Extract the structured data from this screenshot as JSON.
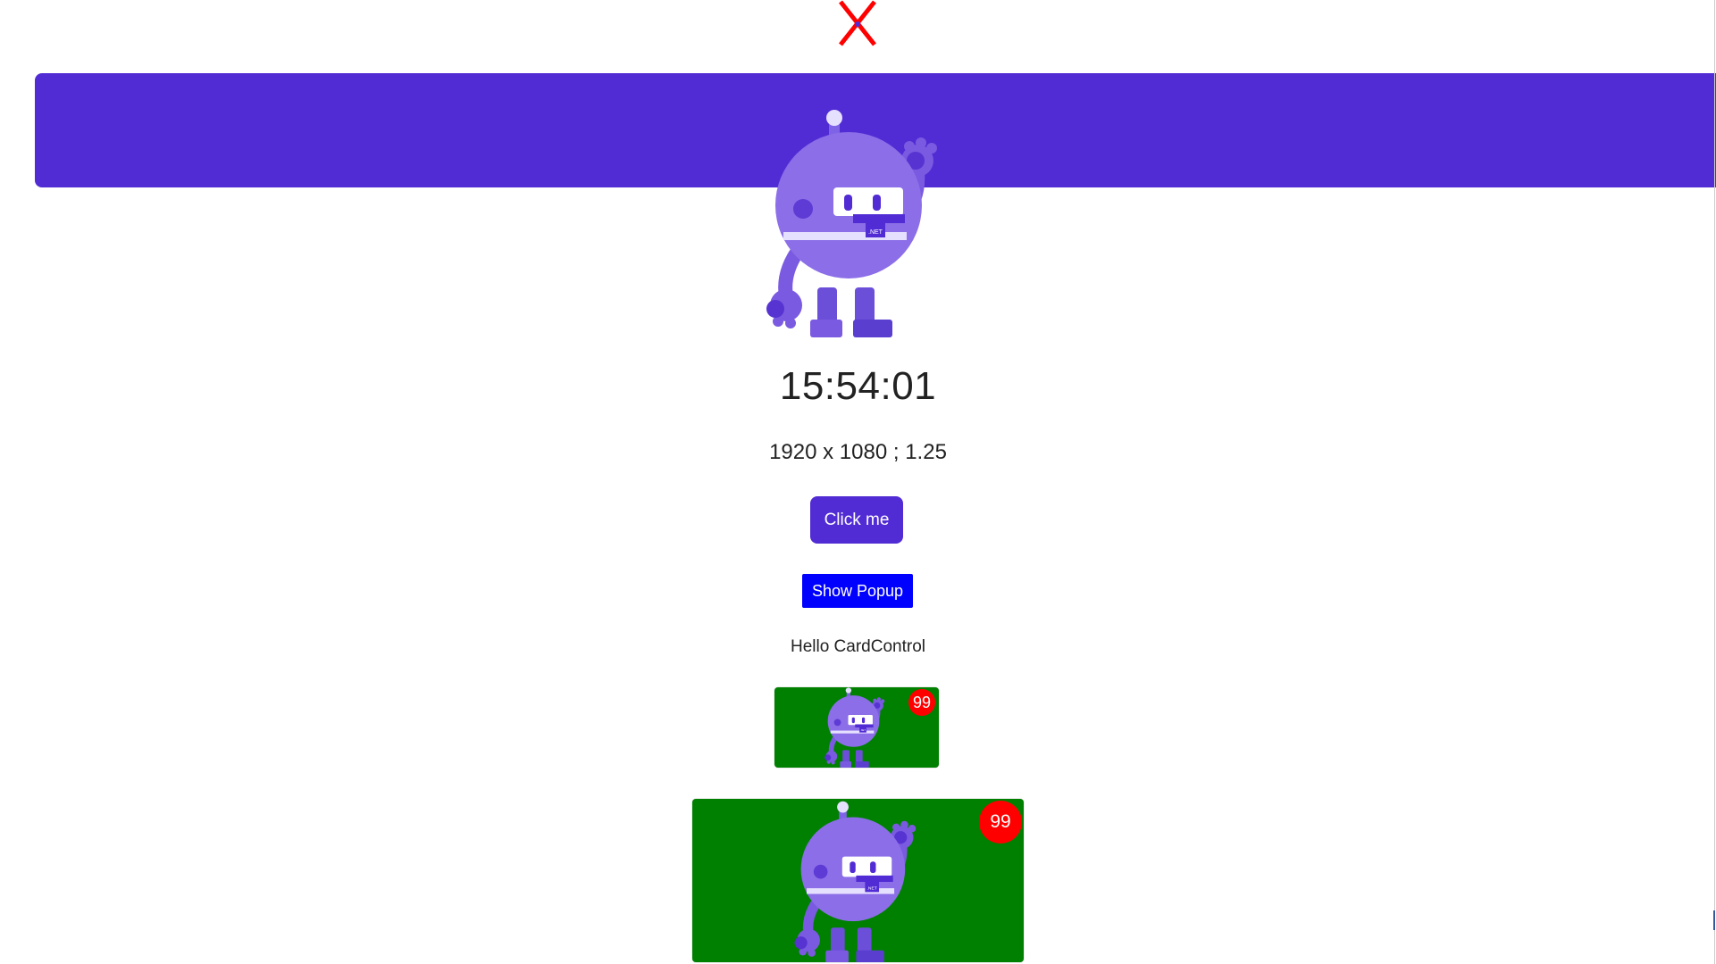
{
  "header": {
    "close_icon": "close-x-icon",
    "close_color": "#ff0000"
  },
  "banner": {
    "color": "#512bd4",
    "mascot_icon": "dotnet-bot-image"
  },
  "main": {
    "clock": "15:54:01",
    "screen_info": "1920 x 1080 ; 1.25",
    "click_button_label": "Click me",
    "click_button_color": "#512bd4",
    "popup_button_label": "Show Popup",
    "popup_button_color": "#0000ff",
    "card_label": "Hello CardControl"
  },
  "cards": [
    {
      "badge": "99",
      "image_icon": "dotnet-bot-image",
      "background": "#008000",
      "badge_color": "#ff0000"
    },
    {
      "badge": "99",
      "image_icon": "dotnet-bot-image",
      "background": "#008000",
      "badge_color": "#ff0000"
    }
  ]
}
